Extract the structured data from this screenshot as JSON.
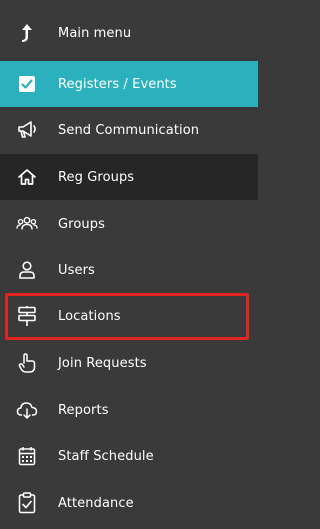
{
  "sidebar": {
    "items": [
      {
        "label": "Main menu",
        "icon": "up-arrow-icon"
      },
      {
        "label": "Registers / Events",
        "icon": "checkbox-icon"
      },
      {
        "label": "Send Communication",
        "icon": "megaphone-icon"
      },
      {
        "label": "Reg Groups",
        "icon": "home-icon"
      },
      {
        "label": "Groups",
        "icon": "people-group-icon"
      },
      {
        "label": "Users",
        "icon": "user-icon"
      },
      {
        "label": "Locations",
        "icon": "signpost-icon"
      },
      {
        "label": "Join Requests",
        "icon": "hand-pointer-icon"
      },
      {
        "label": "Reports",
        "icon": "cloud-download-icon"
      },
      {
        "label": "Staff Schedule",
        "icon": "calendar-icon"
      },
      {
        "label": "Attendance",
        "icon": "clipboard-check-icon"
      }
    ]
  },
  "colors": {
    "sidebar_bg": "#3a3a3a",
    "active_bg": "#2bb0bd",
    "hover_bg": "#262626",
    "highlight_border": "#e0241f"
  }
}
